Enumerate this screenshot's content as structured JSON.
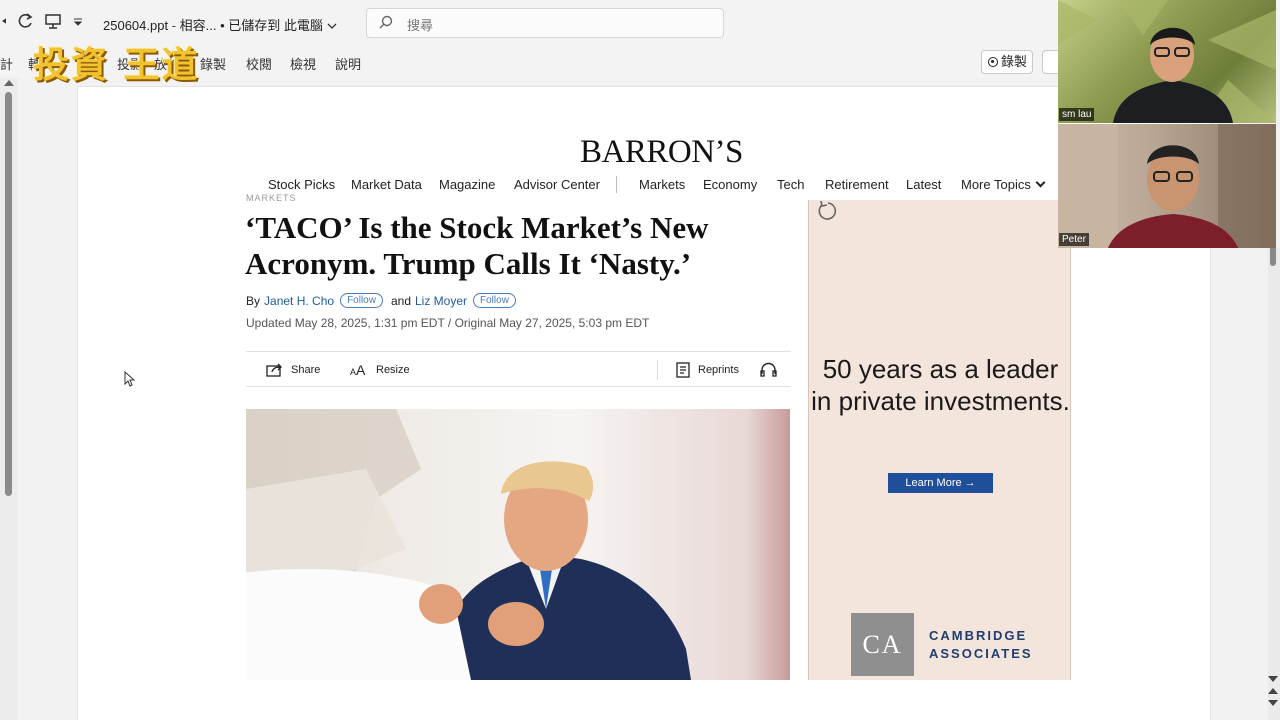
{
  "titlebar": {
    "filename": "250604.ppt",
    "status_compat": "相容...",
    "status_saved": "• 已儲存到 此電腦",
    "search_placeholder": "搜尋"
  },
  "ribbon": {
    "tabs": [
      "計",
      "轉",
      "投影",
      "放映",
      "錄製",
      "校閱",
      "檢視",
      "說明"
    ],
    "record_button": "錄製"
  },
  "logo_overlay": "投資 王道",
  "article": {
    "masthead": "BARRON’S",
    "nav_left": [
      "Stock Picks",
      "Market Data",
      "Magazine",
      "Advisor Center"
    ],
    "nav_right": [
      "Markets",
      "Economy",
      "Tech",
      "Retirement",
      "Latest",
      "More Topics"
    ],
    "kicker": "MARKETS",
    "headline": "‘TACO’ Is the Stock Market’s New Acronym. Trump Calls It ‘Nasty.’",
    "by": "By",
    "author1": "Janet H. Cho",
    "and": "and",
    "author2": "Liz Moyer",
    "follow_label": "Follow",
    "dateline": "Updated May 28, 2025, 1:31 pm EDT / Original May 27, 2025, 5:03 pm EDT",
    "tools": {
      "share": "Share",
      "resize": "Resize",
      "reprints": "Reprints"
    }
  },
  "ad": {
    "text": "50 years as a leader in private investments.",
    "button": "Learn More →",
    "logo": "CA",
    "brand_line1": "CAMBRIDGE",
    "brand_line2": "ASSOCIATES"
  },
  "participants": [
    {
      "name": "sm lau"
    },
    {
      "name": "Peter"
    }
  ],
  "colors": {
    "link_blue": "#1f5b9c",
    "ad_bg": "#f4e5dc",
    "ad_button": "#1f4f9a"
  }
}
